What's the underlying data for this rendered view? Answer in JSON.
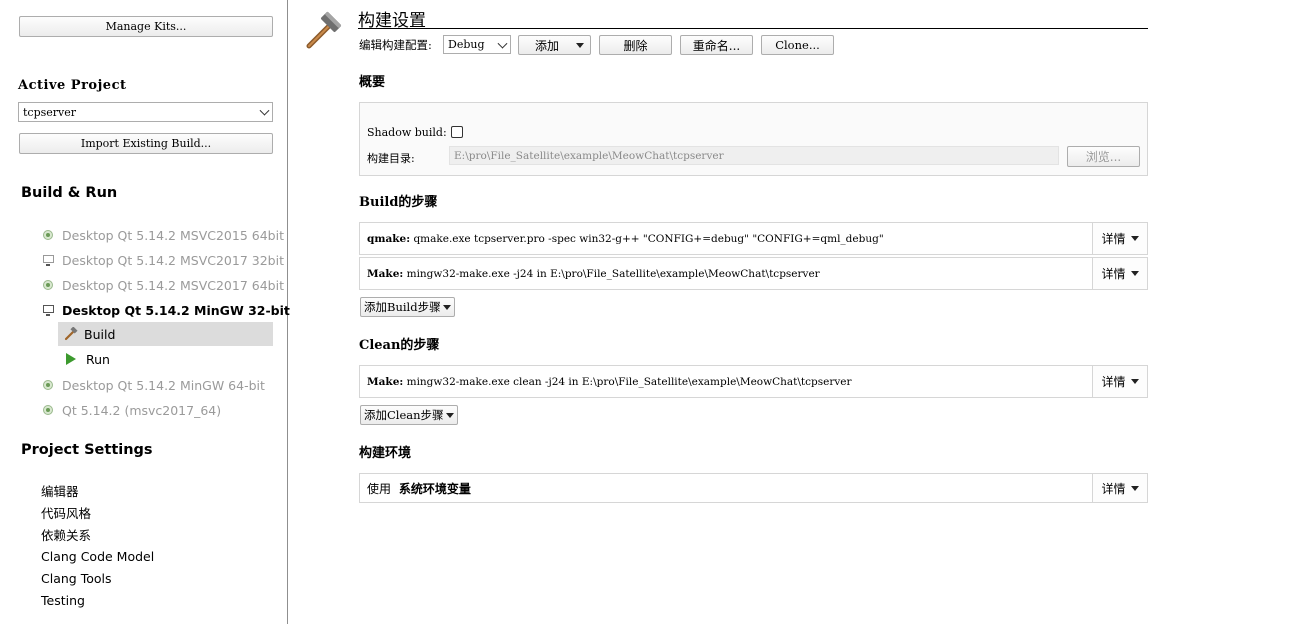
{
  "sidebar": {
    "manage_kits": "Manage Kits...",
    "active_project_heading": "Active Project",
    "active_project_value": "tcpserver",
    "import_build": "Import Existing Build...",
    "build_run_heading": "Build & Run",
    "kits": [
      {
        "label": "Desktop Qt 5.14.2 MSVC2015 64bit"
      },
      {
        "label": "Desktop Qt 5.14.2 MSVC2017 32bit"
      },
      {
        "label": "Desktop Qt 5.14.2 MSVC2017 64bit"
      },
      {
        "label": "Desktop Qt 5.14.2 MinGW 32-bit"
      },
      {
        "label": "Desktop Qt 5.14.2 MinGW 64-bit"
      },
      {
        "label": "Qt 5.14.2 (msvc2017_64)"
      }
    ],
    "active_kit_build": "Build",
    "active_kit_run": "Run",
    "project_settings_heading": "Project Settings",
    "settings_items": [
      "编辑器",
      "代码风格",
      "依赖关系",
      "Clang Code Model",
      "Clang Tools",
      "Testing"
    ]
  },
  "main": {
    "title": "构建设置",
    "edit_config_label": "编辑构建配置:",
    "config_value": "Debug",
    "add_label": "添加",
    "delete_label": "删除",
    "rename_label": "重命名...",
    "clone_label": "Clone...",
    "overview_heading": "概要",
    "shadow_build_label": "Shadow build:",
    "build_dir_label": "构建目录:",
    "build_dir_value": "E:\\pro\\File_Satellite\\example\\MeowChat\\tcpserver",
    "browse_label": "浏览...",
    "build_steps_heading": "Build的步骤",
    "build_steps": [
      {
        "name": "qmake:",
        "command": "qmake.exe tcpserver.pro -spec win32-g++ \"CONFIG+=debug\" \"CONFIG+=qml_debug\""
      },
      {
        "name": "Make:",
        "command": "mingw32-make.exe -j24 in E:\\pro\\File_Satellite\\example\\MeowChat\\tcpserver"
      }
    ],
    "add_build_step": "添加Build步骤",
    "clean_steps_heading": "Clean的步骤",
    "clean_steps": [
      {
        "name": "Make:",
        "command": "mingw32-make.exe clean -j24 in E:\\pro\\File_Satellite\\example\\MeowChat\\tcpserver"
      }
    ],
    "add_clean_step": "添加Clean步骤",
    "env_heading": "构建环境",
    "env_use": "使用",
    "env_value": "系统环境变量",
    "details_label": "详情"
  }
}
